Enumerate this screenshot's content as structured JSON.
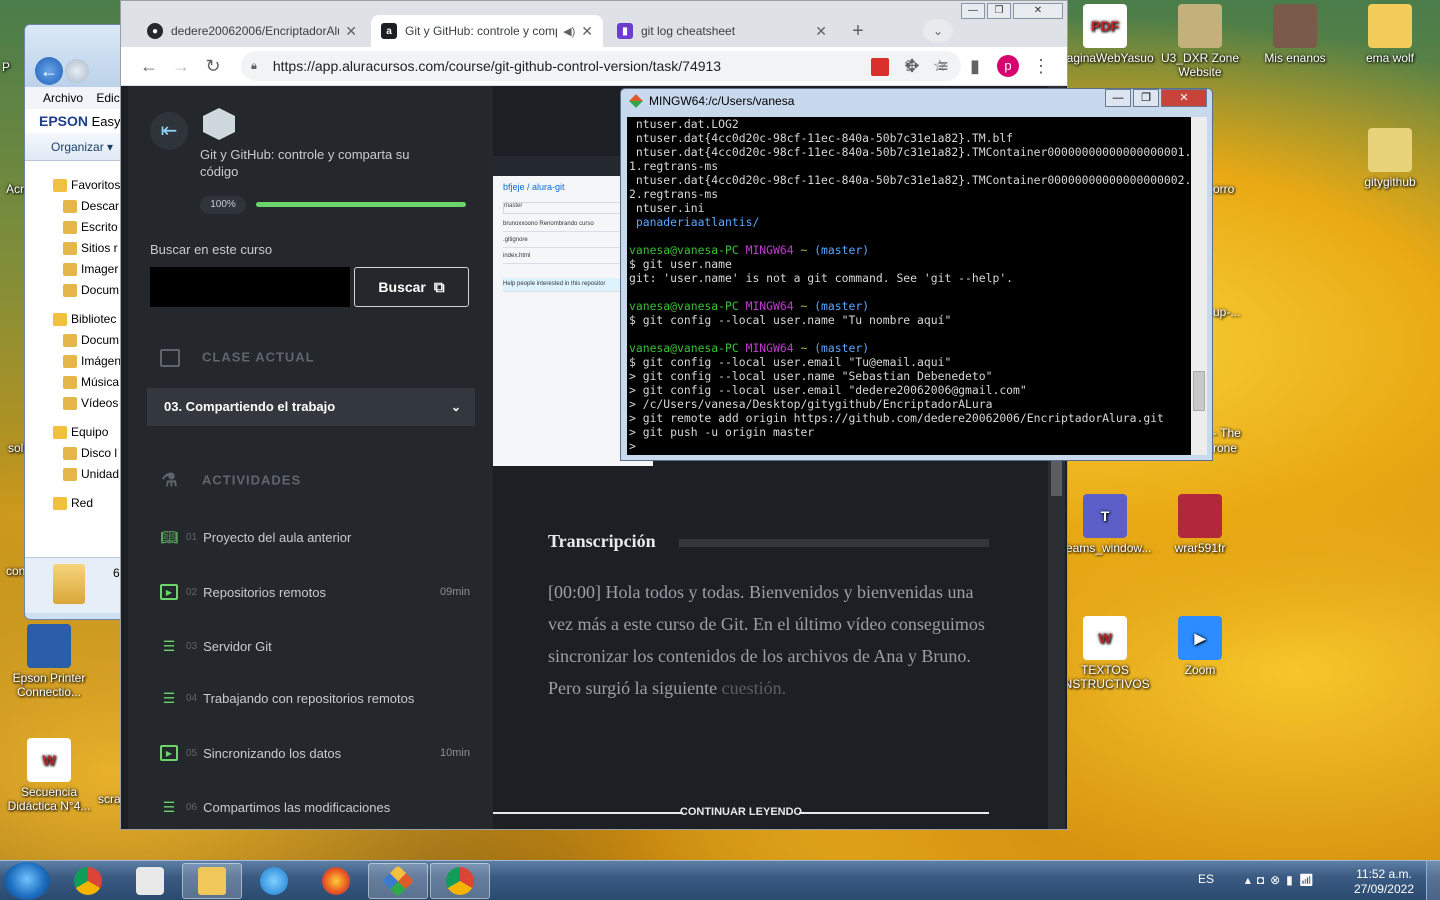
{
  "desktop": {
    "icons": [
      {
        "label": "paginaWebYasuo",
        "color": "#ffffff",
        "glyph": "PDF"
      },
      {
        "label": "U3_DXR Zone Website",
        "color": "#c4b07a",
        "glyph": ""
      },
      {
        "label": "Mis enanos",
        "color": "#7a5a4a",
        "glyph": ""
      },
      {
        "label": "ema wolf",
        "color": "#f2cc5a",
        "glyph": ""
      },
      {
        "label": "gitygithub",
        "color": "#e8d27a",
        "glyph": ""
      },
      {
        "label": "Teams_window...",
        "color": "#5b5fc7",
        "glyph": "T"
      },
      {
        "label": "wrar591fr",
        "color": "#b0283a",
        "glyph": ""
      },
      {
        "label": "TEXTOS INSTRUCTIVOS",
        "color": "#ffffff",
        "glyph": "W"
      },
      {
        "label": "Zoom",
        "color": "#2d8cff",
        "glyph": "▶"
      },
      {
        "label": "Epson Printer Connectio...",
        "color": "#2a5ea8",
        "glyph": ""
      },
      {
        "label": "Secuencia Didáctica N°4...",
        "color": "#ffffff",
        "glyph": "W"
      }
    ],
    "edge_labels": {
      "orro": "orro",
      "up": "up-...",
      "the": "- The",
      "rone": "rone",
      "scra": "scra",
      "ac": "Acr",
      "sol": "sol",
      "con": "con",
      "p": "P"
    }
  },
  "explorer": {
    "menu": [
      "Archivo",
      "Edic"
    ],
    "brand": "EPSON",
    "brand_rest": "Easy",
    "organize": "Organizar",
    "tree": [
      {
        "label": "Favoritos",
        "type": "h"
      },
      {
        "label": "Descar",
        "type": "i"
      },
      {
        "label": "Escrito",
        "type": "i"
      },
      {
        "label": "Sitios r",
        "type": "i"
      },
      {
        "label": "Imager",
        "type": "i"
      },
      {
        "label": "Docum",
        "type": "i"
      },
      {
        "label": "Bibliotec",
        "type": "h"
      },
      {
        "label": "Docum",
        "type": "i"
      },
      {
        "label": "Imágen",
        "type": "i"
      },
      {
        "label": "Música",
        "type": "i"
      },
      {
        "label": "Vídeos",
        "type": "i"
      },
      {
        "label": "Equipo",
        "type": "h"
      },
      {
        "label": "Disco l",
        "type": "i"
      },
      {
        "label": "Unidad",
        "type": "i"
      },
      {
        "label": "Red",
        "type": "h"
      }
    ],
    "count": "6"
  },
  "browser": {
    "tabs": [
      {
        "title": "dedere20062006/EncriptadorAlura",
        "favicon_color": "#24292f",
        "favicon": "●"
      },
      {
        "title": "Git y GitHub: controle y compar",
        "favicon_color": "#1c1f24",
        "favicon": "a"
      },
      {
        "title": "git log cheatsheet",
        "favicon_color": "#6c3bd1",
        "favicon": "▮"
      }
    ],
    "url": "https://app.aluracursos.com/course/git-github-control-version/task/74913",
    "profile_initial": "p",
    "accent": "#d6006e"
  },
  "sidebar": {
    "course_title": "Git y GitHub: controle y comparta su código",
    "progress_label": "100%",
    "progress": 1.0,
    "search_label": "Buscar en este curso",
    "search_placeholder": "",
    "search_button": "Buscar",
    "section_current": "CLASE ACTUAL",
    "current_class": "03. Compartiendo el trabajo",
    "section_activities": "ACTIVIDADES",
    "activities": [
      {
        "num": "01",
        "label": "Proyecto del aula anterior",
        "duration": "",
        "icon": "book"
      },
      {
        "num": "02",
        "label": "Repositorios remotos",
        "duration": "09min",
        "icon": "play"
      },
      {
        "num": "03",
        "label": "Servidor Git",
        "duration": "",
        "icon": "list"
      },
      {
        "num": "04",
        "label": "Trabajando con repositorios remotos",
        "duration": "",
        "icon": "list"
      },
      {
        "num": "05",
        "label": "Sincronizando los datos",
        "duration": "10min",
        "icon": "play"
      },
      {
        "num": "06",
        "label": "Compartimos las modificaciones",
        "duration": "",
        "icon": "list"
      }
    ]
  },
  "content": {
    "transcript_title": "Transcripción",
    "transcript_text": "[00:00] Hola todos y todas. Bienvenidos y bienvenidas una vez más a este curso de Git. En el último vídeo conseguimos sincronizar los contenidos de los archivos de Ana y Bruno. Pero surgió la siguiente",
    "transcript_fade": "cuestión.",
    "continue": "CONTINUAR LEYENDO",
    "screenshot": {
      "repo": "bfjeje / alura-git",
      "branch": "master",
      "files": [
        "brunoxxoono Renombrando curso",
        ".gitignore",
        "index.html"
      ],
      "about": "Help people interested in this repositor"
    }
  },
  "terminal": {
    "title": "MINGW64:/c/Users/vanesa",
    "lines": [
      {
        "t": " ntuser.dat.LOG2",
        "c": ""
      },
      {
        "t": " ntuser.dat{4cc0d20c-98cf-11ec-840a-50b7c31e1a82}.TM.blf",
        "c": ""
      },
      {
        "t": " ntuser.dat{4cc0d20c-98cf-11ec-840a-50b7c31e1a82}.TMContainer00000000000000000001.regtrans-ms",
        "c": ""
      },
      {
        "t": "1.regtrans-ms",
        "c": ""
      },
      {
        "t": " ntuser.dat{4cc0d20c-98cf-11ec-840a-50b7c31e1a82}.TMContainer00000000000000000002.regtrans-ms",
        "c": ""
      },
      {
        "t": "2.regtrans-ms",
        "c": ""
      },
      {
        "t": " ntuser.ini",
        "c": ""
      },
      {
        "t": " panaderiaatlantis/",
        "c": "b"
      },
      {
        "t": "",
        "c": ""
      },
      {
        "p": true,
        "user": "vanesa@vanesa-PC",
        "sys": "MINGW64",
        "path": "~",
        "branch": "(master)"
      },
      {
        "t": "$ git user.name",
        "c": ""
      },
      {
        "t": "git: 'user.name' is not a git command. See 'git --help'.",
        "c": ""
      },
      {
        "t": "",
        "c": ""
      },
      {
        "p": true,
        "user": "vanesa@vanesa-PC",
        "sys": "MINGW64",
        "path": "~",
        "branch": "(master)"
      },
      {
        "t": "$ git config --local user.name \"Tu nombre aquí\"",
        "c": ""
      },
      {
        "t": "",
        "c": ""
      },
      {
        "p": true,
        "user": "vanesa@vanesa-PC",
        "sys": "MINGW64",
        "path": "~",
        "branch": "(master)"
      },
      {
        "t": "$ git config --local user.email \"Tu@email.aqui\"",
        "c": ""
      },
      {
        "t": "> git config --local user.name \"Sebastian Debenedeto\"",
        "c": ""
      },
      {
        "t": "> git config --local user.email \"dedere20062006@gmail.com\"",
        "c": ""
      },
      {
        "t": "> /c/Users/vanesa/Desktop/gitygithub/EncriptadorALura",
        "c": ""
      },
      {
        "t": "> git remote add origin https://github.com/dedere20062006/EncriptadorAlura.git",
        "c": ""
      },
      {
        "t": "> git push -u origin master",
        "c": ""
      },
      {
        "t": ">",
        "c": ""
      }
    ]
  },
  "taskbar": {
    "language": "ES",
    "time": "11:52 a.m.",
    "date": "27/09/2022"
  }
}
